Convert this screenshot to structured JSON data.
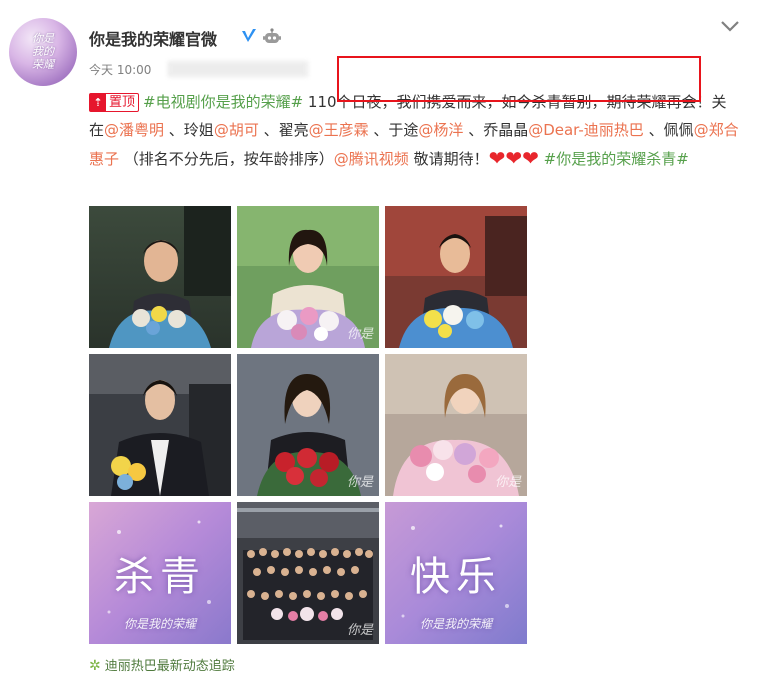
{
  "post": {
    "author_name": "你是我的荣耀官微",
    "avatar_text_line1": "你是",
    "avatar_text_line2": "我的",
    "avatar_text_line3": "荣耀",
    "time": "今天 10:00",
    "pin_badge": "置顶",
    "verified_color": "#2d91f2",
    "icons": [
      "verified-icon",
      "robot-icon",
      "chevron-down-icon",
      "pin-icon",
      "heart-icon",
      "clover-icon"
    ]
  },
  "content": {
    "hashtag1": "#电视剧你是我的荣耀#",
    "text1": " 110个日夜，我们携爱而来，如今杀青暂别，期待荣耀再会！关在",
    "mention1": "@潘粤明",
    "text2": " 、玲姐",
    "mention2": "@胡可",
    "text3": " 、翟亮",
    "mention3": "@王彦霖",
    "text4": " 、于途",
    "mention4": "@杨洋",
    "text5": " 、乔晶晶",
    "mention5": "@Dear-迪丽热巴",
    "text6": " 、佩佩",
    "mention6": "@郑合惠子",
    "text7": " （排名不分先后，按年龄排序）",
    "mention7": "@腾讯视频",
    "text8": " 敬请期待！",
    "hearts": "❤❤❤",
    "hashtag2": "#你是我的荣耀杀青#"
  },
  "images": {
    "watermark": "你是",
    "tile7_big": "杀青",
    "tile7_small": "你是我的荣耀",
    "tile9_big": "快乐",
    "tile9_small": "你是我的荣耀"
  },
  "footer": {
    "label": "迪丽热巴最新动态追踪"
  },
  "colors": {
    "link": "#eb7350",
    "hashtag": "#56a04b",
    "highlight_box": "#e8141c",
    "pin": "#e6162d"
  }
}
